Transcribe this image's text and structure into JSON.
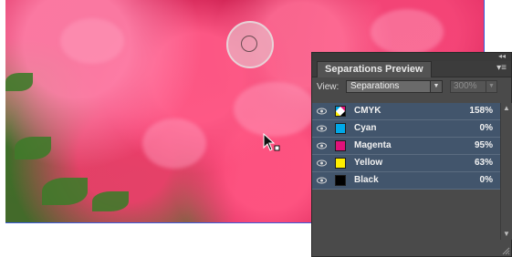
{
  "panel": {
    "title": "Separations Preview",
    "view_label": "View:",
    "view_value": "Separations",
    "zoom_value": "300%"
  },
  "icons": {
    "collapse": "double-chevron-left-icon",
    "panel_menu": "panel-menu-icon",
    "visibility": "eye-icon",
    "scroll_up": "arrow-up-icon",
    "scroll_down": "arrow-down-icon"
  },
  "separations": [
    {
      "name": "CMYK",
      "percent": "158%",
      "color": "cmyk"
    },
    {
      "name": "Cyan",
      "percent": "0%",
      "color": "#00a8e8"
    },
    {
      "name": "Magenta",
      "percent": "95%",
      "color": "#e0117a"
    },
    {
      "name": "Yellow",
      "percent": "63%",
      "color": "#ffee00"
    },
    {
      "name": "Black",
      "percent": "0%",
      "color": "#000000"
    }
  ],
  "colors": {
    "panel_bg": "#4a4a4a",
    "row_bg": "#42556c",
    "photo_border": "#3b5bdb"
  }
}
